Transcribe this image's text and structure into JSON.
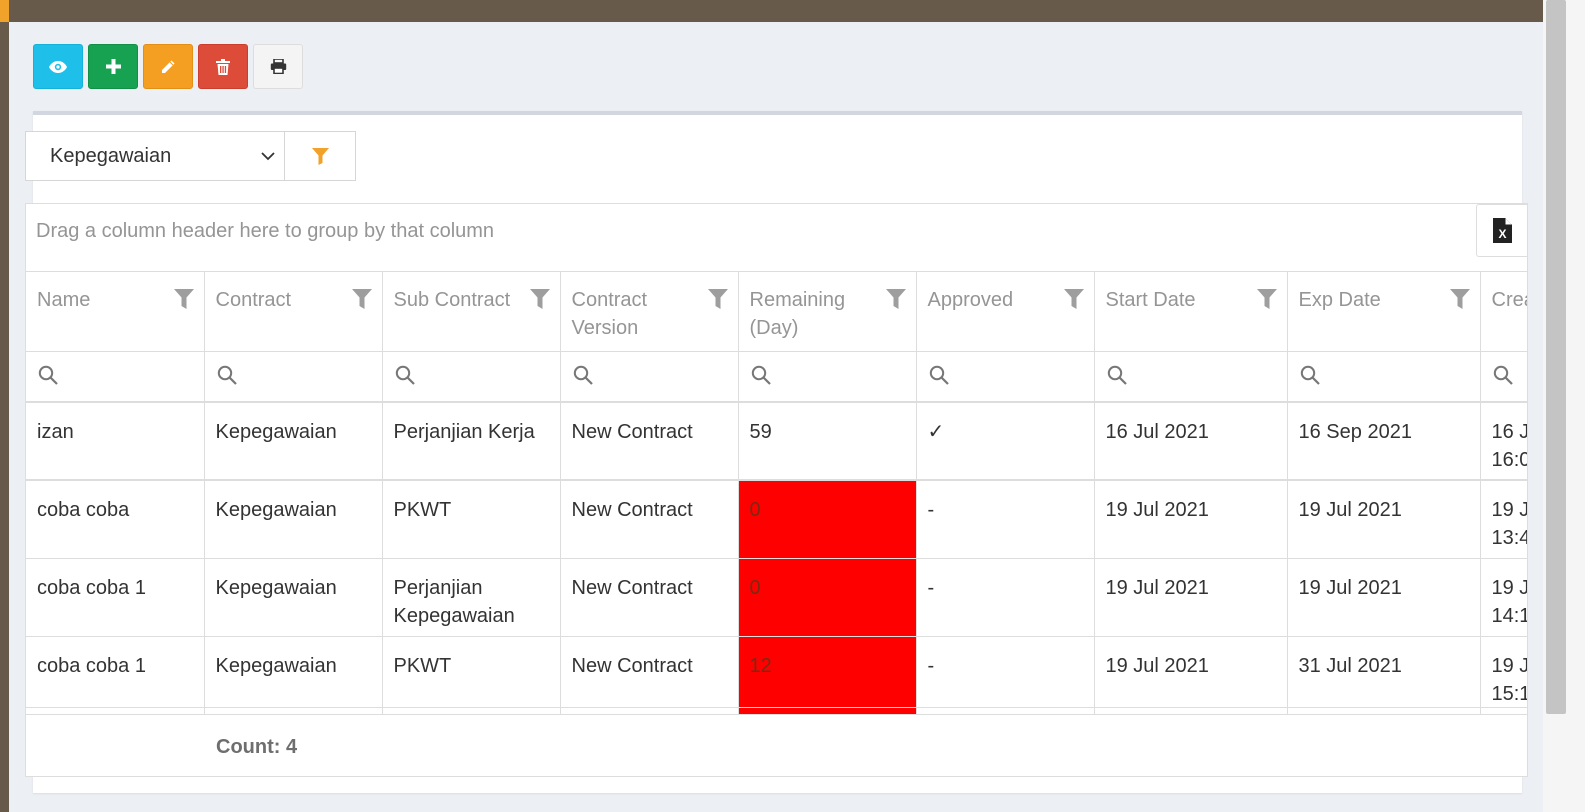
{
  "toolbar": {
    "buttons": [
      {
        "name": "view",
        "icon": "eye-icon",
        "color": "#1ec0ea"
      },
      {
        "name": "add",
        "icon": "plus-icon",
        "color": "#17a251"
      },
      {
        "name": "edit",
        "icon": "pencil-icon",
        "color": "#f59f22"
      },
      {
        "name": "delete",
        "icon": "trash-icon",
        "color": "#dd4b39"
      },
      {
        "name": "print",
        "icon": "printer-icon",
        "color": "#f4f4f4"
      }
    ]
  },
  "filter": {
    "selected": "Kepegawaian",
    "filter_icon": "filter-icon",
    "filter_icon_color": "#f0a22b"
  },
  "grid": {
    "group_panel_text": "Drag a column header here to group by that column",
    "export_icon": "excel-export-icon",
    "columns": [
      "Name",
      "Contract",
      "Sub Contract",
      "Contract Version",
      "Remaining (Day)",
      "Approved",
      "Start Date",
      "Exp Date",
      "Created"
    ],
    "columns_display": {
      "name": "Name",
      "contract": "Contract",
      "sub_contract": "Sub Contract",
      "contract_version_1": "Contract",
      "contract_version_2": "Version",
      "remaining_1": "Remaining",
      "remaining_2": "(Day)",
      "approved": "Approved",
      "start_date": "Start Date",
      "exp_date": "Exp Date",
      "created_partial": "Crea"
    },
    "rows": [
      {
        "name": "izan",
        "contract": "Kepegawaian",
        "sub_contract": "Perjanjian Kerja",
        "version": "New Contract",
        "remaining": "59",
        "remaining_alert": false,
        "approved": "✓",
        "start": "16 Jul 2021",
        "exp": "16 Sep 2021",
        "created_1": "16 J",
        "created_2": "16:0"
      },
      {
        "name": "coba coba",
        "contract": "Kepegawaian",
        "sub_contract": "PKWT",
        "version": "New Contract",
        "remaining": "0",
        "remaining_alert": true,
        "approved": "-",
        "start": "19 Jul 2021",
        "exp": "19 Jul 2021",
        "created_1": "19 J",
        "created_2": "13:4"
      },
      {
        "name": "coba coba 1",
        "contract": "Kepegawaian",
        "sub_contract": "Perjanjian Kepegawaian",
        "version": "New Contract",
        "remaining": "0",
        "remaining_alert": true,
        "approved": "-",
        "start": "19 Jul 2021",
        "exp": "19 Jul 2021",
        "created_1": "19 J",
        "created_2": "14:1"
      },
      {
        "name": "coba coba 1",
        "contract": "Kepegawaian",
        "sub_contract": "PKWT",
        "version": "New Contract",
        "remaining": "12",
        "remaining_alert": true,
        "approved": "-",
        "start": "19 Jul 2021",
        "exp": "31 Jul 2021",
        "created_1": "19 J",
        "created_2": "15:1"
      }
    ],
    "footer_count": "Count: 4",
    "alert_color": "#ff0000"
  }
}
